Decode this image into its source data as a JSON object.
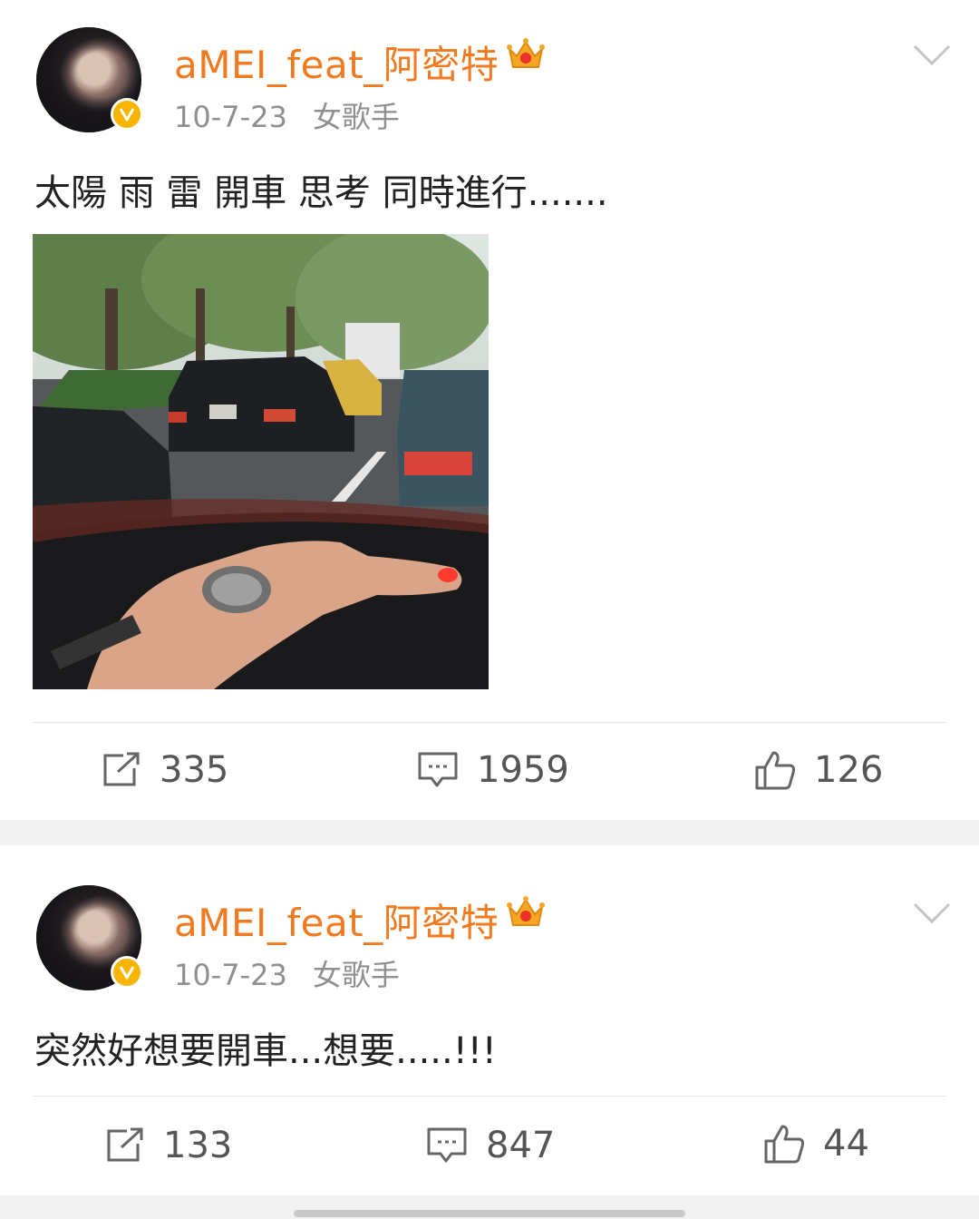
{
  "posts": [
    {
      "username": "aMEI_feat_阿密特",
      "date": "10-7-23",
      "tag": "女歌手",
      "text": "太陽 雨 雷 開車 思考 同時進行.......",
      "has_photo": true,
      "reposts": "335",
      "comments": "1959",
      "likes": "126"
    },
    {
      "username": "aMEI_feat_阿密特",
      "date": "10-7-23",
      "tag": "女歌手",
      "text": "突然好想要開車...想要.....!!!",
      "has_photo": false,
      "reposts": "133",
      "comments": "847",
      "likes": "44"
    }
  ],
  "colors": {
    "username": "#f07a1f",
    "meta": "#8f8f8f",
    "verified_badge": "#f7b500",
    "separator": "#f2f2f2"
  },
  "icons": [
    "crown-icon",
    "verified-icon",
    "chevron-down-icon",
    "repost-icon",
    "comment-icon",
    "like-icon"
  ]
}
